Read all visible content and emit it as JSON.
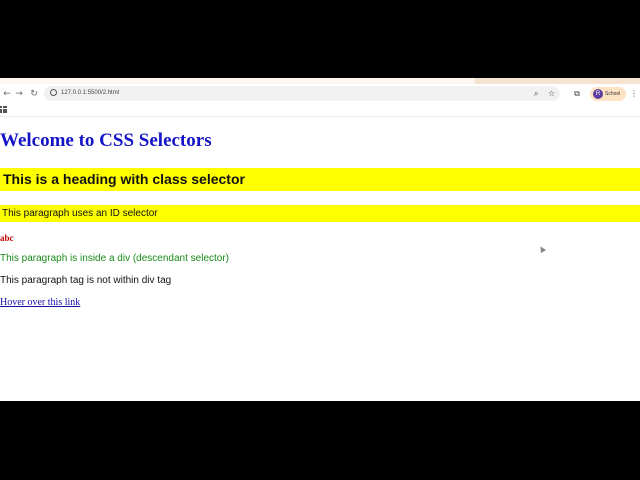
{
  "browser": {
    "url": "127.0.0.1:5500/2.html",
    "nav_icons": {
      "back": "←",
      "forward": "→",
      "reload": "↻"
    },
    "toolbar_icons": {
      "zoom": "⌕",
      "star": "☆",
      "extensions": "⧉",
      "menu": "⋮"
    },
    "profile": {
      "avatar_letter": "R",
      "label": "School"
    }
  },
  "page": {
    "title": "Welcome to CSS Selectors",
    "class_heading": "This is a heading with class selector",
    "id_paragraph": "This paragraph uses an ID selector",
    "abc_text": "abc",
    "descendant_paragraph": "This paragraph is inside a div (descendant selector)",
    "plain_paragraph": "This paragraph tag is not within div tag",
    "hover_link": "Hover over this link"
  },
  "colors": {
    "title": "#1515c8",
    "highlight": "#ffff00",
    "abc": "#c00000",
    "descendant": "#1a8a1a",
    "link": "#1a0dab"
  }
}
